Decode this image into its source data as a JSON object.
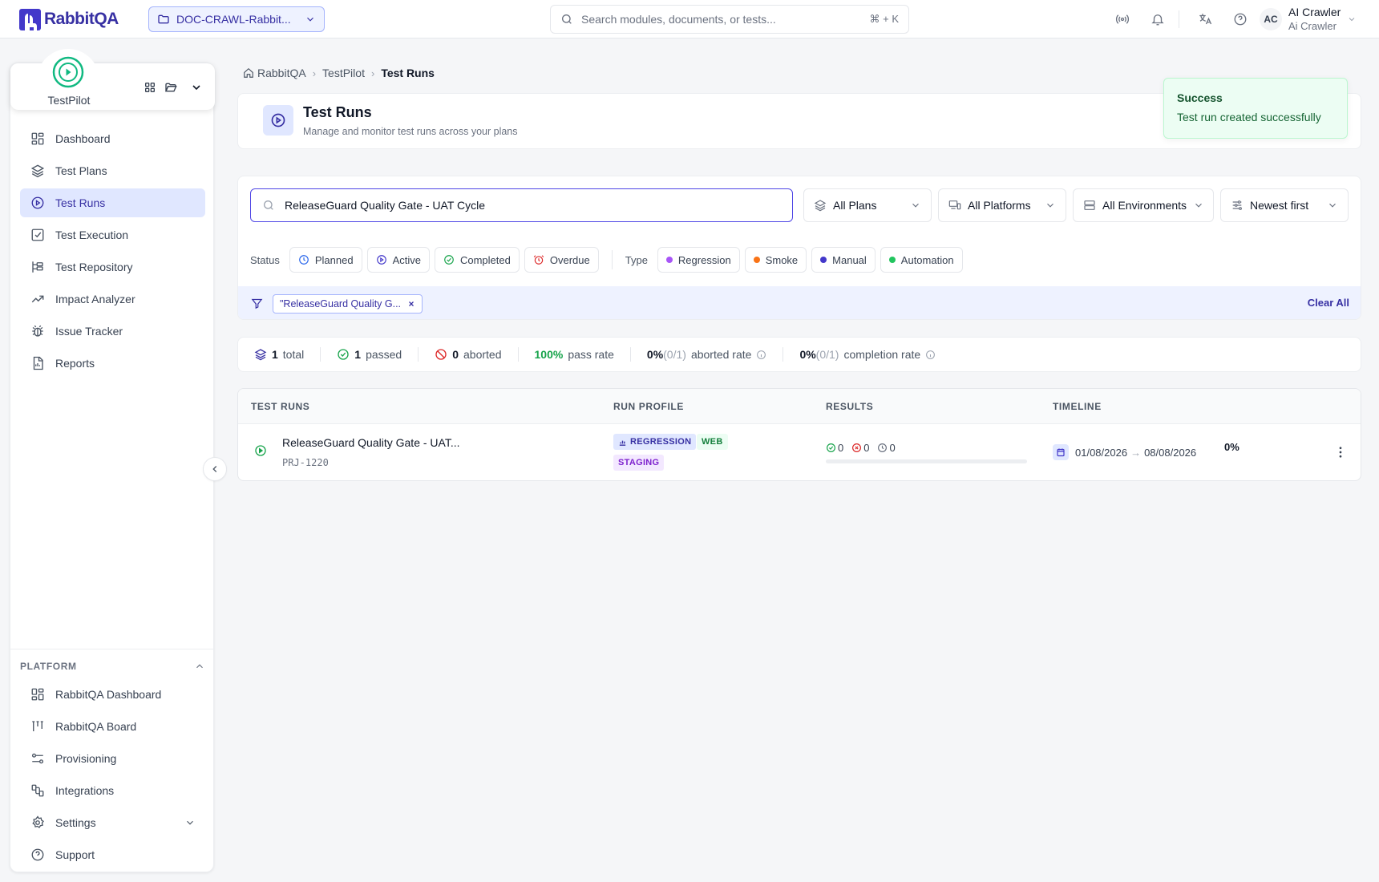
{
  "brand": {
    "name": "RabbitQA"
  },
  "project_selector": {
    "label": "DOC-CRAWL-Rabbit..."
  },
  "global_search": {
    "placeholder": "Search modules, documents, or tests...",
    "shortcut": "⌘ + K"
  },
  "user": {
    "initials": "AC",
    "name": "AI Crawler",
    "role": "Ai Crawler"
  },
  "module": {
    "name": "TestPilot"
  },
  "sidebar": {
    "items": [
      {
        "label": "Dashboard",
        "icon": "dashboard-icon"
      },
      {
        "label": "Test Plans",
        "icon": "layers-icon"
      },
      {
        "label": "Test Runs",
        "icon": "play-circle-icon",
        "active": true
      },
      {
        "label": "Test Execution",
        "icon": "checkbox-icon"
      },
      {
        "label": "Test Repository",
        "icon": "tree-icon"
      },
      {
        "label": "Impact Analyzer",
        "icon": "trend-icon"
      },
      {
        "label": "Issue Tracker",
        "icon": "bug-icon"
      },
      {
        "label": "Reports",
        "icon": "report-icon"
      }
    ],
    "platform_heading": "PLATFORM",
    "platform_items": [
      {
        "label": "RabbitQA Dashboard",
        "icon": "dashboard-icon"
      },
      {
        "label": "RabbitQA Board",
        "icon": "board-icon"
      },
      {
        "label": "Provisioning",
        "icon": "provisioning-icon"
      },
      {
        "label": "Integrations",
        "icon": "integrations-icon"
      },
      {
        "label": "Settings",
        "icon": "gear-icon"
      },
      {
        "label": "Support",
        "icon": "help-icon"
      }
    ]
  },
  "breadcrumb": {
    "items": [
      "RabbitQA",
      "TestPilot",
      "Test Runs"
    ]
  },
  "page": {
    "title": "Test Runs",
    "subtitle": "Manage and monitor test runs across your plans"
  },
  "toast": {
    "title": "Success",
    "message": "Test run created successfully"
  },
  "filters": {
    "search_value": "ReleaseGuard Quality Gate - UAT Cycle",
    "plans": "All Plans",
    "platforms": "All Platforms",
    "environments": "All Environments",
    "sort": "Newest first",
    "status_label": "Status",
    "statuses": [
      {
        "label": "Planned",
        "color": "#2563eb"
      },
      {
        "label": "Active",
        "color": "#4338ca"
      },
      {
        "label": "Completed",
        "color": "#16a34a"
      },
      {
        "label": "Overdue",
        "color": "#dc2626"
      }
    ],
    "type_label": "Type",
    "types": [
      {
        "label": "Regression",
        "color": "#a855f7"
      },
      {
        "label": "Smoke",
        "color": "#f97316"
      },
      {
        "label": "Manual",
        "color": "#4338ca"
      },
      {
        "label": "Automation",
        "color": "#22c55e"
      }
    ],
    "active_chip": "\"ReleaseGuard Quality G...",
    "clear_all": "Clear All"
  },
  "stats": {
    "total": "1",
    "total_label": "total",
    "passed": "1",
    "passed_label": "passed",
    "aborted": "0",
    "aborted_label": "aborted",
    "pass_rate": "100%",
    "pass_rate_label": "pass rate",
    "aborted_rate": "0%",
    "aborted_rate_frac": "(0/1)",
    "aborted_rate_label": "aborted rate",
    "completion_rate": "0%",
    "completion_rate_frac": "(0/1)",
    "completion_rate_label": "completion rate"
  },
  "table": {
    "headers": [
      "TEST RUNS",
      "RUN PROFILE",
      "RESULTS",
      "TIMELINE"
    ],
    "rows": [
      {
        "name": "ReleaseGuard Quality Gate - UAT...",
        "id": "PRJ-1220",
        "tags": [
          "REGRESSION",
          "WEB",
          "STAGING"
        ],
        "passed": "0",
        "failed": "0",
        "pending": "0",
        "progress": "0%",
        "progress_fraction": 0,
        "start": "01/08/2026",
        "arrow": "→",
        "end": "08/08/2026"
      }
    ]
  },
  "colors": {
    "accent": "#3730a3",
    "success": "#16a34a",
    "danger": "#dc2626"
  }
}
